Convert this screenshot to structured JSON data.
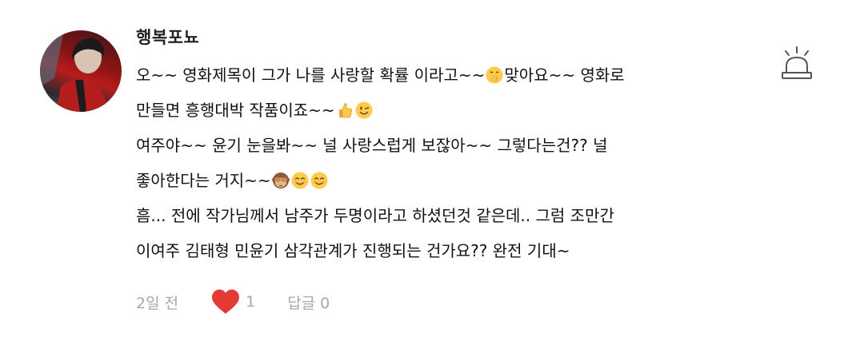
{
  "comment": {
    "username": "행복포뇨",
    "lines": [
      {
        "text": "오~~ 영화제목이 그가 나를 사랑할 확률 이라고~~",
        "emoji": "shush-face-icon",
        "rest": "맞아요~~  영화로"
      },
      {
        "text": "만들면 흥행대박 작품이죠~~",
        "emoji": "thumbs-up-icon",
        "emoji2": "wink-face-icon"
      },
      {
        "text": "여주야~~  윤기 눈을봐~~ 널 사랑스럽게 보잖아~~ 그렇다는건??  널"
      },
      {
        "text": "좋아한다는 거지~~",
        "emoji": "see-no-evil-monkey-icon",
        "emoji2": "smiling-face-icon",
        "emoji3": "smiling-face-icon"
      },
      {
        "text": "흠...  전에 작가님께서 남주가 두명이라고 하셨던것 같은데..  그럼 조만간"
      },
      {
        "text": "이여주 김태형 민윤기 삼각관계가 진행되는  건가요??  완전 기대~"
      }
    ],
    "time": "2일 전",
    "like_count": "1",
    "reply_label": "답글 0"
  },
  "icons": {
    "report": "siren-alarm-icon",
    "like": "heart-icon"
  },
  "colors": {
    "heart": "#e53935",
    "muted_text": "#a8a8a8",
    "body_text": "#111111"
  }
}
